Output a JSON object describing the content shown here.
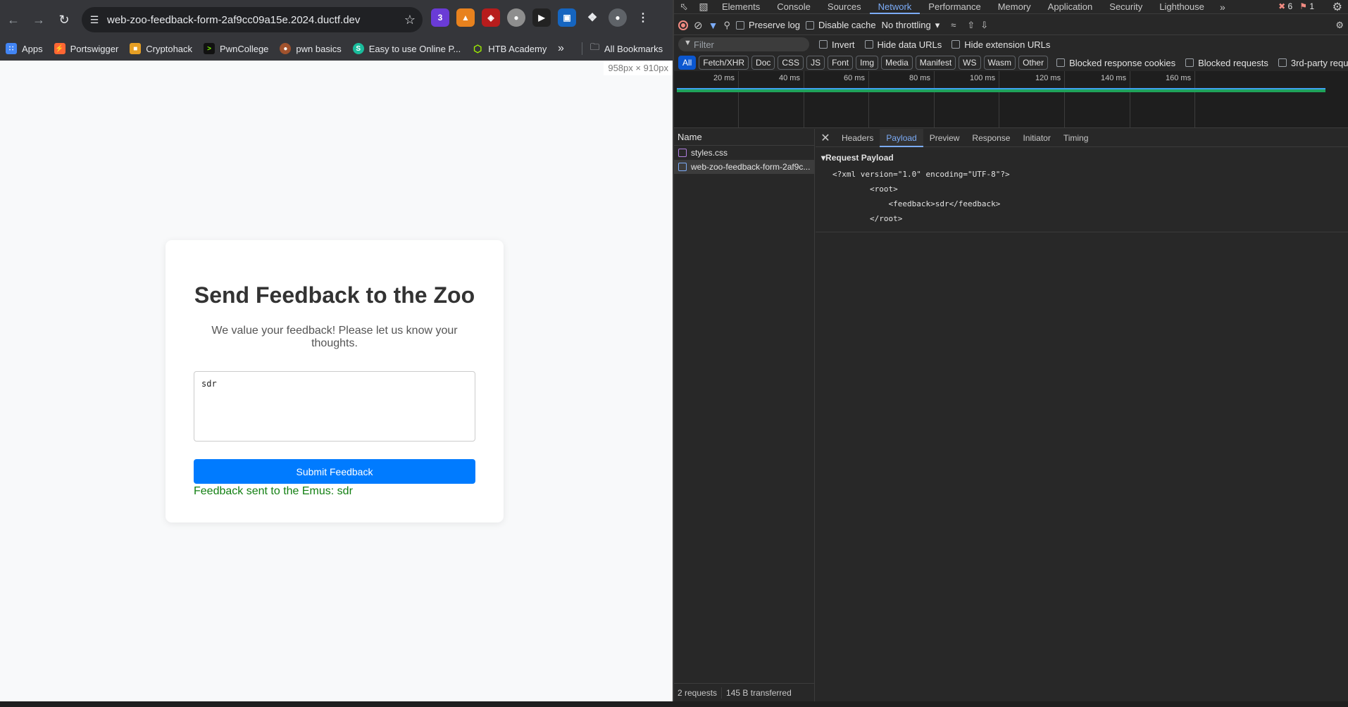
{
  "browser": {
    "url": "web-zoo-feedback-form-2af9cc09a15e.2024.ductf.dev",
    "extensions": [
      "3"
    ],
    "bookmarks": [
      "Apps",
      "Portswigger",
      "Cryptohack",
      "PwnCollege",
      "pwn basics",
      "Easy to use Online P...",
      "HTB Academy"
    ],
    "all_bookmarks": "All Bookmarks",
    "dimensions": "958px × 910px"
  },
  "page": {
    "title": "Send Feedback to the Zoo",
    "subtitle": "We value your feedback! Please let us know your thoughts.",
    "feedback_value": "sdr",
    "submit_label": "Submit Feedback",
    "result": "Feedback sent to the Emus: sdr"
  },
  "devtools": {
    "tabs": [
      "Elements",
      "Console",
      "Sources",
      "Network",
      "Performance",
      "Memory",
      "Application",
      "Security",
      "Lighthouse"
    ],
    "active_tab": "Network",
    "error_count": "6",
    "warning_count": "1",
    "toolbar": {
      "preserve_log": "Preserve log",
      "disable_cache": "Disable cache",
      "throttling": "No throttling"
    },
    "filter": {
      "placeholder": "Filter",
      "invert": "Invert",
      "hide_data_urls": "Hide data URLs",
      "hide_extension_urls": "Hide extension URLs"
    },
    "types": [
      "All",
      "Fetch/XHR",
      "Doc",
      "CSS",
      "JS",
      "Font",
      "Img",
      "Media",
      "Manifest",
      "WS",
      "Wasm",
      "Other"
    ],
    "type_extras": [
      "Blocked response cookies",
      "Blocked requests",
      "3rd-party requests"
    ],
    "timeline_ticks": [
      "20 ms",
      "40 ms",
      "60 ms",
      "80 ms",
      "100 ms",
      "120 ms",
      "140 ms",
      "160 ms"
    ],
    "requests_header": "Name",
    "requests": [
      "styles.css",
      "web-zoo-feedback-form-2af9c..."
    ],
    "footer": {
      "requests": "2 requests",
      "transferred": "145 B transferred"
    },
    "detail_tabs": [
      "Headers",
      "Payload",
      "Preview",
      "Response",
      "Initiator",
      "Timing"
    ],
    "active_detail_tab": "Payload",
    "payload_title": "Request Payload",
    "payload_lines": [
      "<?xml version=\"1.0\" encoding=\"UTF-8\"?>",
      "        <root>",
      "            <feedback>sdr</feedback>",
      "        </root>"
    ]
  }
}
